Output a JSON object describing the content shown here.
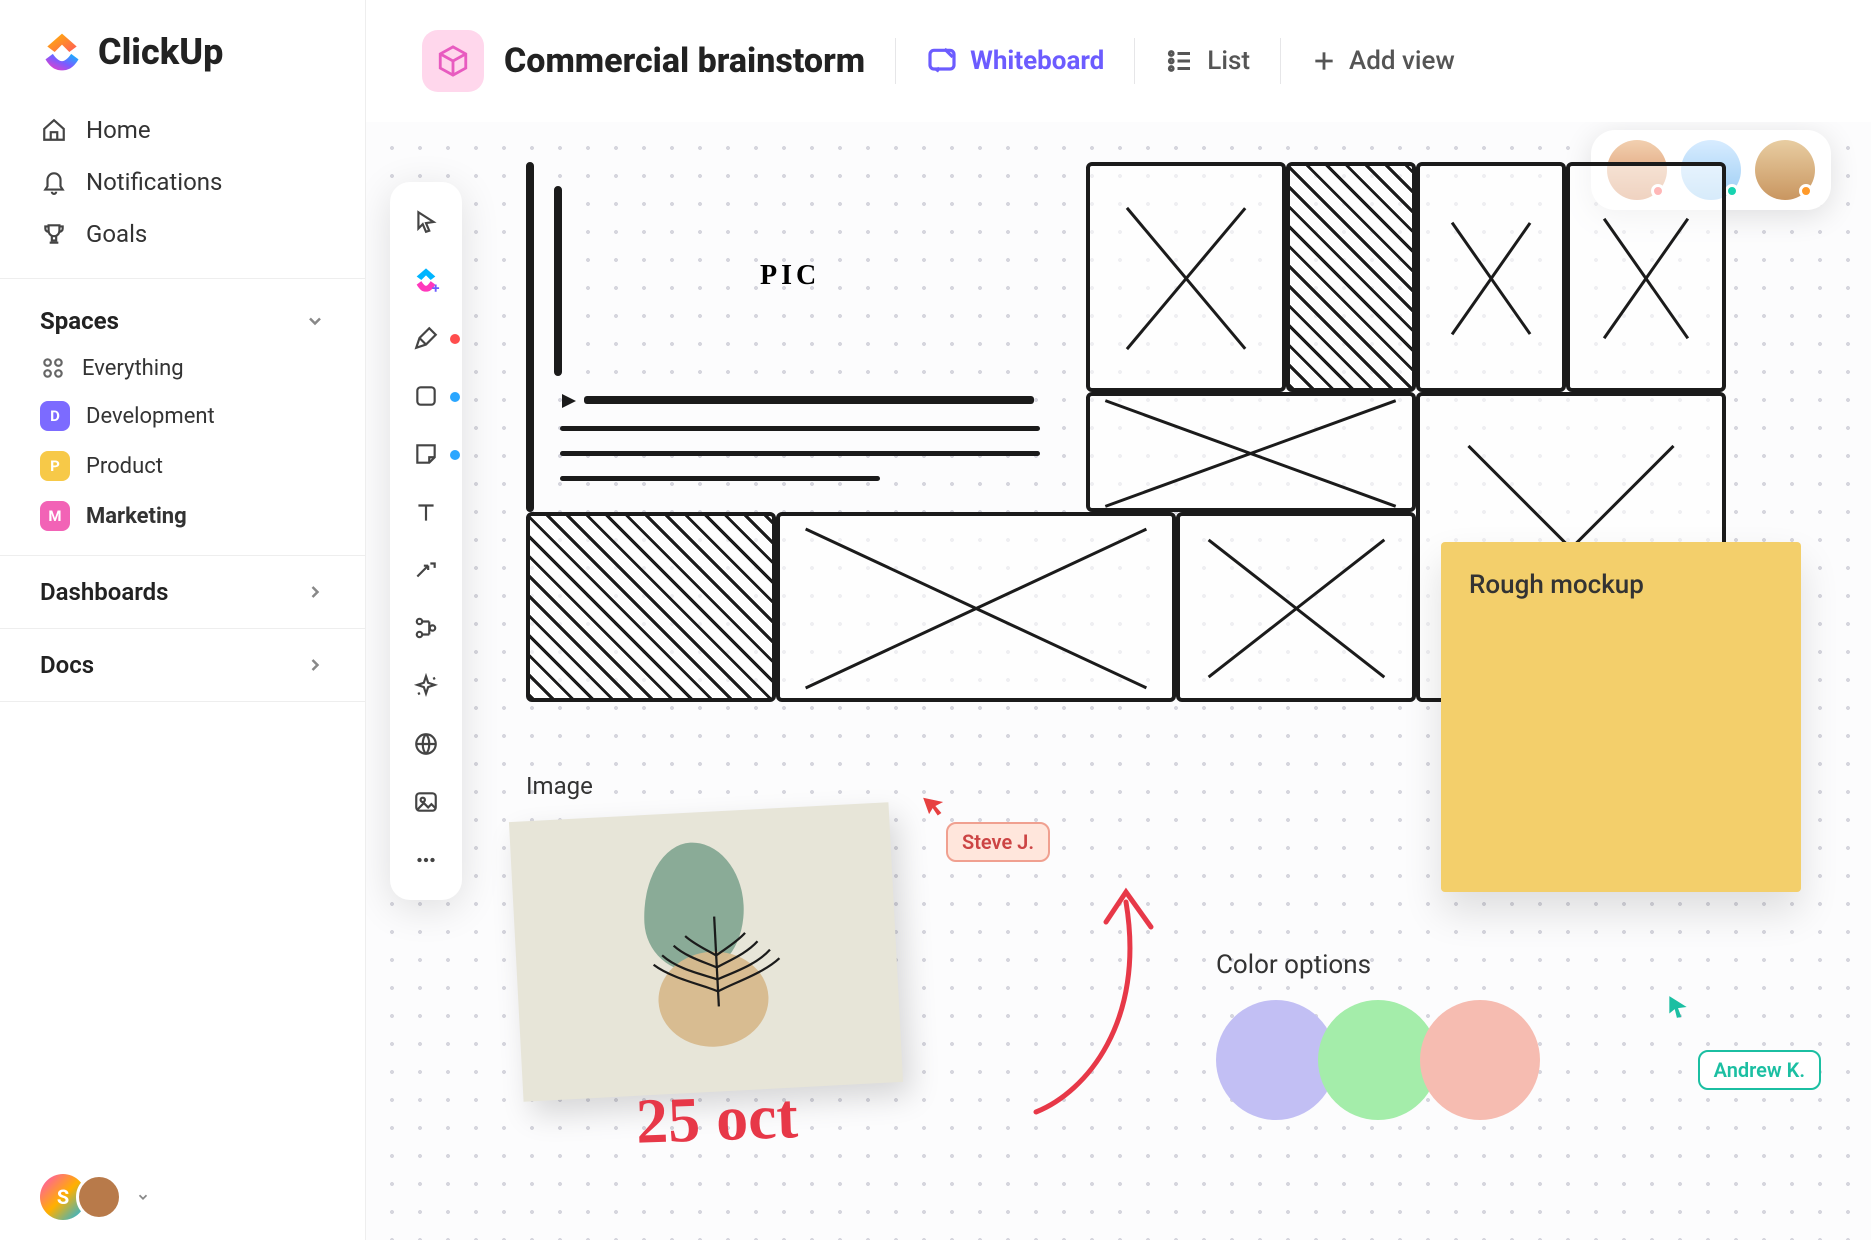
{
  "brand": "ClickUp",
  "nav": {
    "items": [
      {
        "label": "Home",
        "icon": "home-icon"
      },
      {
        "label": "Notifications",
        "icon": "bell-icon"
      },
      {
        "label": "Goals",
        "icon": "trophy-icon"
      }
    ]
  },
  "spaces": {
    "title": "Spaces",
    "everything": "Everything",
    "items": [
      {
        "letter": "D",
        "label": "Development",
        "color": "#7c6bff",
        "active": false
      },
      {
        "letter": "P",
        "label": "Product",
        "color": "#f7c948",
        "active": false
      },
      {
        "letter": "M",
        "label": "Marketing",
        "color": "#f263b6",
        "active": true
      }
    ]
  },
  "secondaryNav": {
    "dashboards": "Dashboards",
    "docs": "Docs"
  },
  "footer": {
    "user_initial": "S"
  },
  "header": {
    "title": "Commercial brainstorm",
    "views": {
      "whiteboard": "Whiteboard",
      "list": "List",
      "add": "Add view"
    }
  },
  "toolbox": {
    "tools": [
      {
        "name": "select",
        "indicator": null
      },
      {
        "name": "clickup",
        "indicator": null
      },
      {
        "name": "pen",
        "indicator": "#ff4d4d"
      },
      {
        "name": "shape",
        "indicator": "#2aa6ff"
      },
      {
        "name": "sticky",
        "indicator": "#2aa6ff"
      },
      {
        "name": "text",
        "indicator": null
      },
      {
        "name": "connector",
        "indicator": null
      },
      {
        "name": "cut",
        "indicator": null
      },
      {
        "name": "sparkle",
        "indicator": null
      },
      {
        "name": "web",
        "indicator": null
      },
      {
        "name": "image",
        "indicator": null
      },
      {
        "name": "more",
        "indicator": null
      }
    ]
  },
  "presence": {
    "people": [
      {
        "bg": "linear-gradient(#e9c7a0,#d89064)",
        "color": "#ff4d4d"
      },
      {
        "bg": "linear-gradient(#cfe9ff,#9bcdf4)",
        "color": "#17d3b0"
      },
      {
        "bg": "linear-gradient(#e6caa0,#c99660)",
        "color": "#ff9a2a"
      }
    ]
  },
  "canvas": {
    "sticky_text": "Rough mockup",
    "image_label": "Image",
    "colors_label": "Color options",
    "swatches": [
      "#c2bff4",
      "#a4edaa",
      "#f6bcb1"
    ],
    "wireframe_pic_label": "PIC",
    "handwriting": "25 oct",
    "cursors": {
      "steve": "Steve J.",
      "andrew": "Andrew K."
    }
  }
}
